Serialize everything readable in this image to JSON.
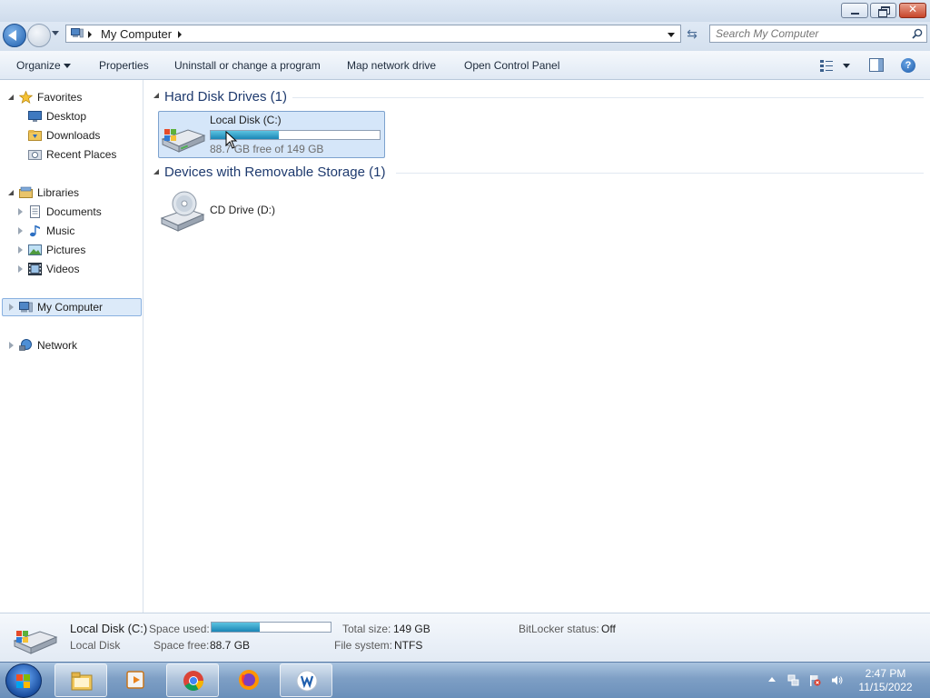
{
  "window": {
    "address_path": "My Computer",
    "search_placeholder": "Search My Computer"
  },
  "toolbar": {
    "organize": "Organize",
    "properties": "Properties",
    "uninstall": "Uninstall or change a program",
    "map_drive": "Map network drive",
    "control_panel": "Open Control Panel"
  },
  "nav": {
    "favorites": "Favorites",
    "desktop": "Desktop",
    "downloads": "Downloads",
    "recent": "Recent Places",
    "libraries": "Libraries",
    "documents": "Documents",
    "music": "Music",
    "pictures": "Pictures",
    "videos": "Videos",
    "my_computer": "My Computer",
    "network": "Network"
  },
  "content": {
    "group_hdd": "Hard Disk Drives (1)",
    "group_removable": "Devices with Removable Storage (1)",
    "drive_c": {
      "name": "Local Disk (C:)",
      "free_text": "88.7 GB free of 149 GB",
      "used_fraction": 0.405
    },
    "drive_d": {
      "name": "CD Drive (D:)"
    }
  },
  "details": {
    "name": "Local Disk (C:)",
    "type": "Local Disk",
    "space_used_label": "Space used:",
    "space_free_label": "Space free:",
    "space_free": "88.7 GB",
    "total_size_label": "Total size:",
    "total_size": "149 GB",
    "file_system_label": "File system:",
    "file_system": "NTFS",
    "bitlocker_label": "BitLocker status:",
    "bitlocker": "Off",
    "used_fraction": 0.405
  },
  "taskbar": {
    "time": "2:47 PM",
    "date": "11/15/2022",
    "apps": [
      "file-explorer",
      "media-player",
      "chrome",
      "firefox",
      "app"
    ]
  },
  "colors": {
    "selection_bg": "#d5e6f9",
    "progress_fill": "#1b86b6",
    "header_text": "#1e3a6e"
  }
}
